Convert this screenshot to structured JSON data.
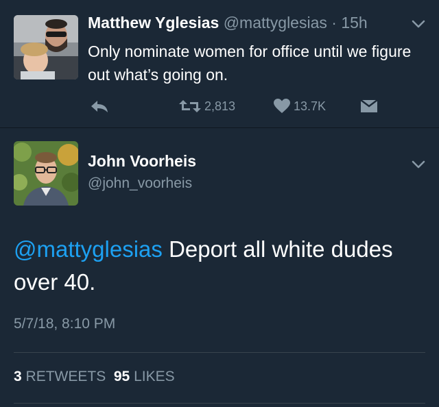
{
  "tweet1": {
    "name": "Matthew Yglesias",
    "handle": "@mattyglesias",
    "separator": "·",
    "age": "15h",
    "text": "Only nominate women for office until we figure out what’s going on.",
    "retweets": "2,813",
    "likes": "13.7K"
  },
  "tweet2": {
    "name": "John Voorheis",
    "handle": "@john_voorheis",
    "mention": "@mattyglesias",
    "text": " Deport all white dudes over 40.",
    "timestamp": "5/7/18, 8:10 PM",
    "retweet_count": "3",
    "retweet_label": "RETWEETS",
    "like_count": "95",
    "like_label": "LIKES"
  },
  "colors": {
    "background": "#1b2836",
    "secondary_text": "#8899a6",
    "link": "#1da1f2",
    "divider": "#38444d"
  },
  "icons": [
    "reply-icon",
    "retweet-icon",
    "heart-icon",
    "direct-message-icon",
    "chevron-down-icon"
  ]
}
